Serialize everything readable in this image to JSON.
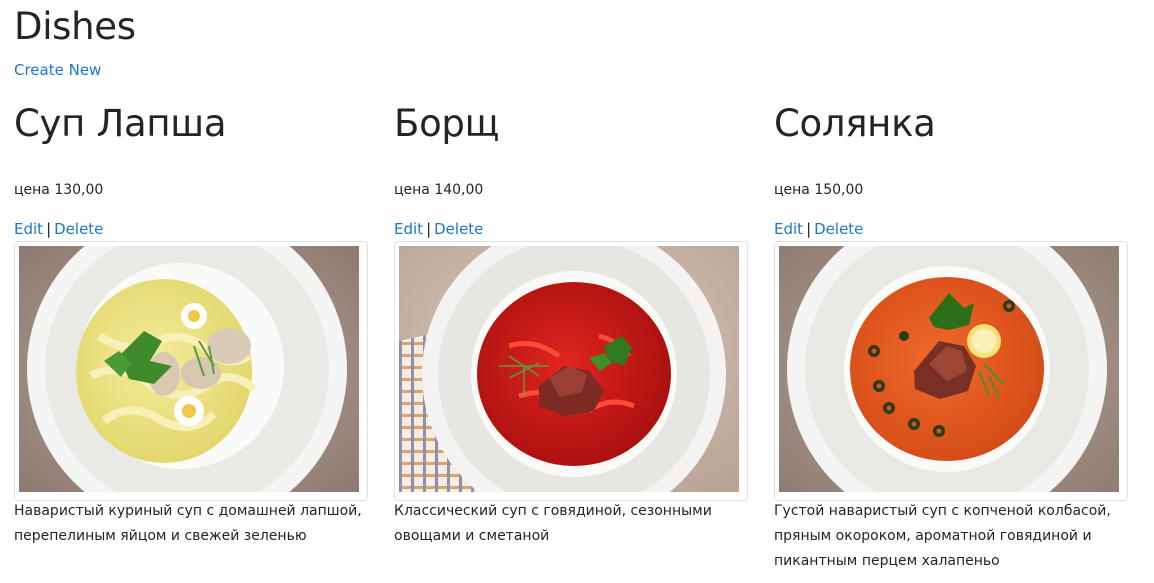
{
  "header": {
    "title": "Dishes",
    "create_new": "Create New"
  },
  "dishes": [
    {
      "name": "Суп Лапша",
      "price": "цена 130,00",
      "edit": "Edit",
      "delete": "Delete",
      "separator": "|",
      "image_icon": "noodle-soup-photo",
      "description": "Наваристый куриный суп с домашней лапшой, перепелиным яйцом и свежей зеленью"
    },
    {
      "name": "Борщ",
      "price": "цена 140,00",
      "edit": "Edit",
      "delete": "Delete",
      "separator": "|",
      "image_icon": "borscht-photo",
      "description": "Классический суп с говядиной, сезонными овощами и сметаной"
    },
    {
      "name": "Солянка",
      "price": "цена 150,00",
      "edit": "Edit",
      "delete": "Delete",
      "separator": "|",
      "image_icon": "solyanka-photo",
      "description": "Густой наваристый суп с копченой колбасой, пряным окороком, ароматной говядиной и пикантным перцем халапеньо"
    }
  ],
  "colors": {
    "link": "#1b76d2",
    "text": "#212529",
    "border": "#dee2e6"
  }
}
